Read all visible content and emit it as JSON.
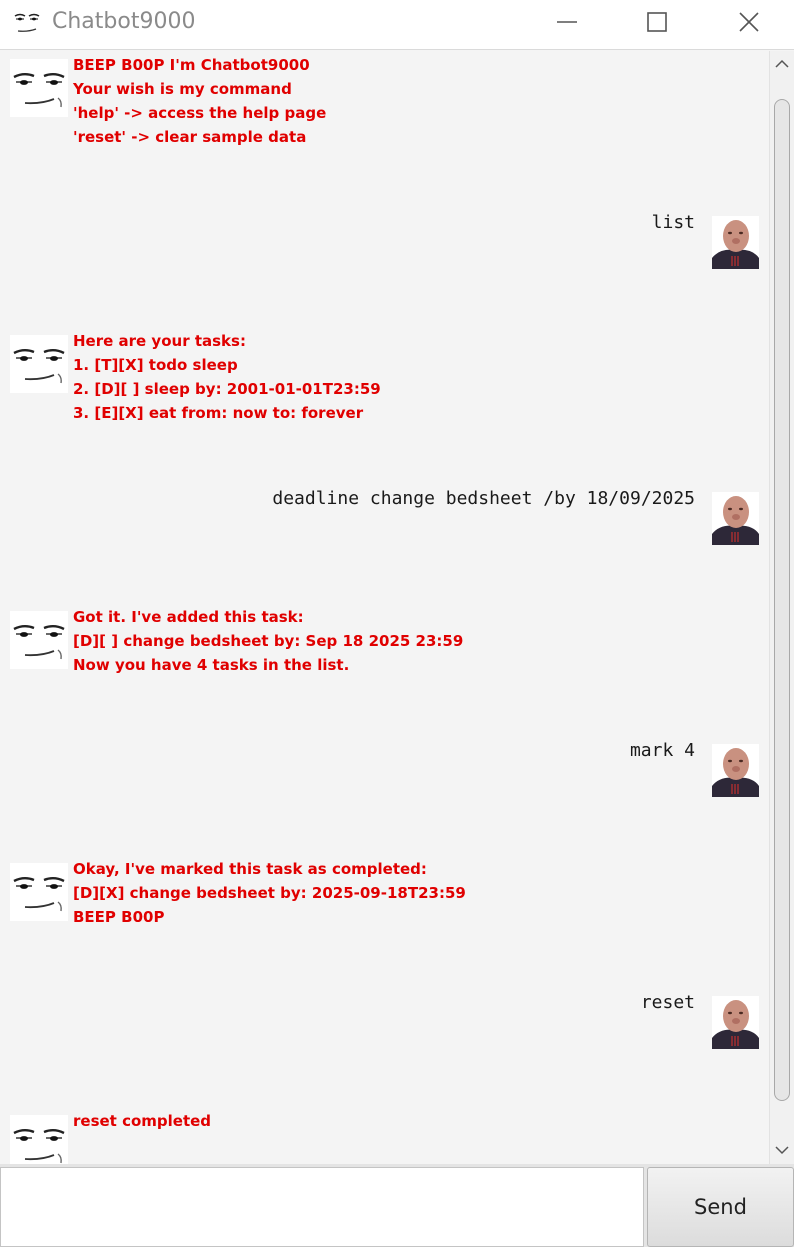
{
  "window": {
    "title": "Chatbot9000",
    "app_icon": "meme-face-icon",
    "controls": [
      "minimize-icon",
      "maximize-icon",
      "close-icon"
    ]
  },
  "messages": [
    {
      "sender": "bot",
      "lines": "BEEP B00P I'm Chatbot9000\nYour wish is my command\n'help' -> access the help page\n'reset' -> clear sample data"
    },
    {
      "sender": "user",
      "text": "list"
    },
    {
      "sender": "bot",
      "lines": "Here are your tasks:\n1. [T][X] todo sleep\n2. [D][ ] sleep by: 2001-01-01T23:59\n3. [E][X] eat from: now to: forever"
    },
    {
      "sender": "user",
      "text": "deadline change bedsheet /by 18/09/2025"
    },
    {
      "sender": "bot",
      "lines": "Got it. I've added this task:\n[D][ ] change bedsheet by: Sep 18 2025 23:59\nNow you have 4 tasks in the list."
    },
    {
      "sender": "user",
      "text": "mark 4"
    },
    {
      "sender": "bot",
      "lines": "Okay, I've marked this task as completed:\n[D][X] change bedsheet by: 2025-09-18T23:59\nBEEP B00P"
    },
    {
      "sender": "user",
      "text": "reset"
    },
    {
      "sender": "bot",
      "lines": "reset completed"
    }
  ],
  "input": {
    "value": "",
    "placeholder": ""
  },
  "send_button": {
    "label": "Send"
  },
  "colors": {
    "bot_text": "#e00000",
    "user_text": "#1a1a1a",
    "background": "#f4f4f4"
  }
}
